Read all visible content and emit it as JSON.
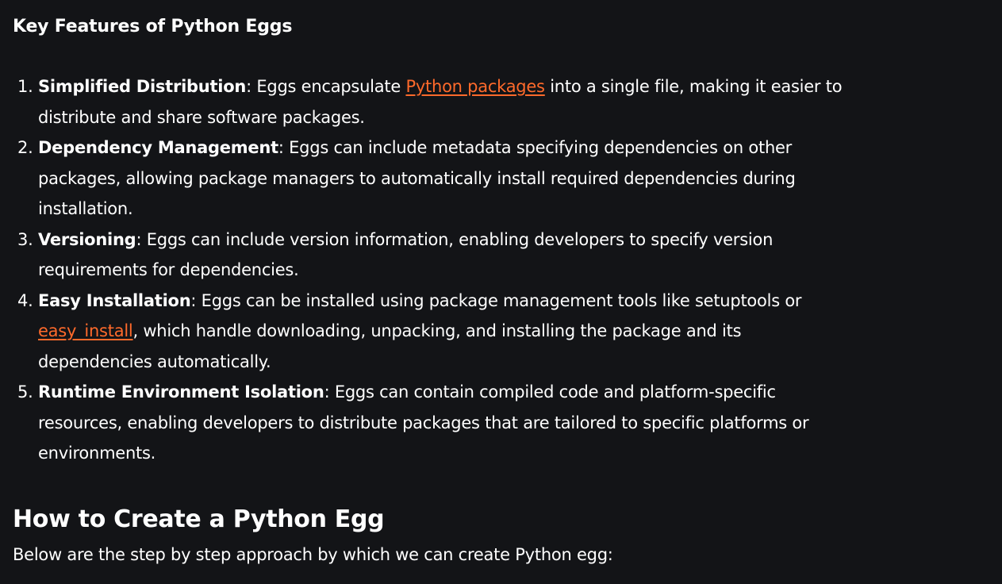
{
  "section": {
    "title": "Key Features of Python Eggs"
  },
  "features": [
    {
      "term": "Simplified Distribution",
      "text_before": ": Eggs encapsulate ",
      "link": "Python packages",
      "text_after": " into a single file, making it easier to distribute and share software packages."
    },
    {
      "term": "Dependency Management",
      "text": ": Eggs can include metadata specifying dependencies on other packages, allowing package managers to automatically install required dependencies during installation."
    },
    {
      "term": "Versioning",
      "text": ": Eggs can include version information, enabling developers to specify version requirements for dependencies."
    },
    {
      "term": "Easy Installation",
      "text_before": ": Eggs can be installed using package management tools like setuptools or ",
      "link": "easy_install",
      "text_after": ", which handle downloading, unpacking, and installing the package and its dependencies automatically."
    },
    {
      "term": "Runtime Environment Isolation",
      "text": ": Eggs can contain compiled code and platform-specific resources, enabling developers to distribute packages that are tailored to specific platforms or environments."
    }
  ],
  "create": {
    "heading": "How to Create a Python Egg",
    "intro": "Below are the step by step approach by which we can create Python egg:"
  },
  "colors": {
    "background": "#131417",
    "text": "#ffffff",
    "link": "#ff6a2b"
  }
}
